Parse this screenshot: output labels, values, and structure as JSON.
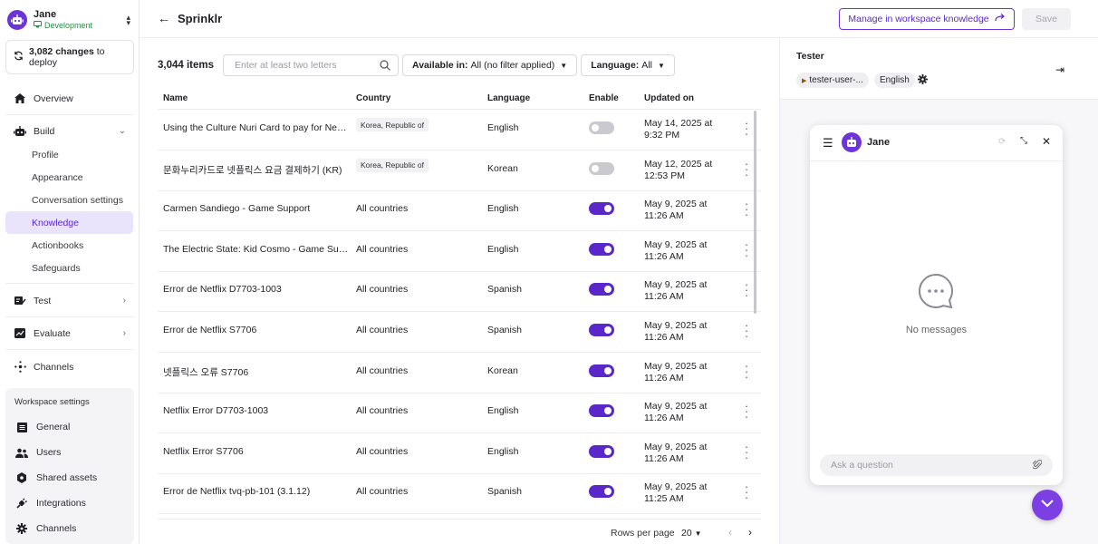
{
  "workspace": {
    "name": "Jane",
    "environment": "Development"
  },
  "deploy": {
    "count_text": "3,082 changes",
    "suffix_text": " to deploy"
  },
  "nav": {
    "overview": "Overview",
    "build": "Build",
    "build_items": [
      "Profile",
      "Appearance",
      "Conversation settings",
      "Knowledge",
      "Actionbooks",
      "Safeguards"
    ],
    "test": "Test",
    "evaluate": "Evaluate",
    "channels": "Channels"
  },
  "workspace_settings": {
    "title": "Workspace settings",
    "items": [
      "General",
      "Users",
      "Shared assets",
      "Integrations",
      "Channels"
    ]
  },
  "header": {
    "title": "Sprinklr",
    "manage_label": "Manage in workspace knowledge",
    "save_label": "Save"
  },
  "toolbar": {
    "count": "3,044 items",
    "search_placeholder": "Enter at least two letters",
    "filter_available_label": "Available in:",
    "filter_available_value": "All (no filter applied)",
    "filter_language_label": "Language:",
    "filter_language_value": "All"
  },
  "table": {
    "columns": [
      "Name",
      "Country",
      "Language",
      "Enable",
      "Updated on"
    ],
    "rows": [
      {
        "name": "Using the Culture Nuri Card to pay for Netf...",
        "country": "Korea, Republic of",
        "country_tag": true,
        "language": "English",
        "enabled": false,
        "date1": "May 14, 2025 at",
        "date2": "9:32 PM"
      },
      {
        "name": "문화누리카드로 넷플릭스 요금 결제하기 (KR)",
        "country": "Korea, Republic of",
        "country_tag": true,
        "language": "Korean",
        "enabled": false,
        "date1": "May 12, 2025 at",
        "date2": "12:53 PM"
      },
      {
        "name": "Carmen Sandiego - Game Support",
        "country": "All countries",
        "country_tag": false,
        "language": "English",
        "enabled": true,
        "date1": "May 9, 2025 at",
        "date2": "11:26 AM"
      },
      {
        "name": "The Electric State: Kid Cosmo - Game Sup...",
        "country": "All countries",
        "country_tag": false,
        "language": "English",
        "enabled": true,
        "date1": "May 9, 2025 at",
        "date2": "11:26 AM"
      },
      {
        "name": "Error de Netflix D7703-1003",
        "country": "All countries",
        "country_tag": false,
        "language": "Spanish",
        "enabled": true,
        "date1": "May 9, 2025 at",
        "date2": "11:26 AM"
      },
      {
        "name": "Error de Netflix S7706",
        "country": "All countries",
        "country_tag": false,
        "language": "Spanish",
        "enabled": true,
        "date1": "May 9, 2025 at",
        "date2": "11:26 AM"
      },
      {
        "name": "넷플릭스 오류 S7706",
        "country": "All countries",
        "country_tag": false,
        "language": "Korean",
        "enabled": true,
        "date1": "May 9, 2025 at",
        "date2": "11:26 AM"
      },
      {
        "name": "Netflix Error D7703-1003",
        "country": "All countries",
        "country_tag": false,
        "language": "English",
        "enabled": true,
        "date1": "May 9, 2025 at",
        "date2": "11:26 AM"
      },
      {
        "name": "Netflix Error S7706",
        "country": "All countries",
        "country_tag": false,
        "language": "English",
        "enabled": true,
        "date1": "May 9, 2025 at",
        "date2": "11:26 AM"
      },
      {
        "name": "Error de Netflix tvq-pb-101 (3.1.12)",
        "country": "All countries",
        "country_tag": false,
        "language": "Spanish",
        "enabled": true,
        "date1": "May 9, 2025 at",
        "date2": "11:25 AM"
      }
    ]
  },
  "pagination": {
    "rows_per_page_label": "Rows per page",
    "rows_per_page_value": "20"
  },
  "tester": {
    "title": "Tester",
    "user_chip": "tester-user-...",
    "language_chip": "English"
  },
  "chat": {
    "name": "Jane",
    "empty_text": "No messages",
    "input_placeholder": "Ask a question"
  },
  "colors": {
    "accent": "#5a28c9",
    "brand": "#6b35d9",
    "active_bg": "#e9e3fb",
    "env_green": "#2f8a45"
  }
}
